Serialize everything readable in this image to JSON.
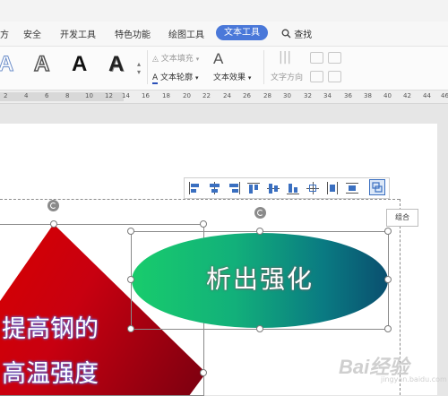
{
  "menu": {
    "items": [
      "方",
      "安全",
      "开发工具",
      "特色功能",
      "绘图工具"
    ],
    "active_tab": "文本工具",
    "search_label": "查找"
  },
  "ribbon": {
    "text_fill": "文本填充",
    "text_outline": "文本轮廓",
    "text_effect": "文本效果",
    "text_direction": "文字方向",
    "style_samples": [
      "A",
      "A",
      "A",
      "A"
    ]
  },
  "ruler": {
    "ticks": [
      "2",
      "4",
      "6",
      "8",
      "10",
      "12",
      "14",
      "16",
      "18",
      "20",
      "22",
      "24",
      "26",
      "28",
      "30",
      "32",
      "34",
      "36",
      "38",
      "40",
      "42",
      "44",
      "46"
    ]
  },
  "canvas": {
    "diamond_lines": [
      "提高钢的",
      "高温强度"
    ],
    "ellipse_text": "析出强化",
    "tooltip": "组合",
    "watermark": "Bai经验",
    "watermark_sub": "jingyan.baidu.com"
  },
  "colors": {
    "accent": "#4a78d9",
    "diamond_red": "#d70000",
    "ellipse_green": "#18cc6c",
    "ellipse_teal": "#0a4f6f"
  }
}
